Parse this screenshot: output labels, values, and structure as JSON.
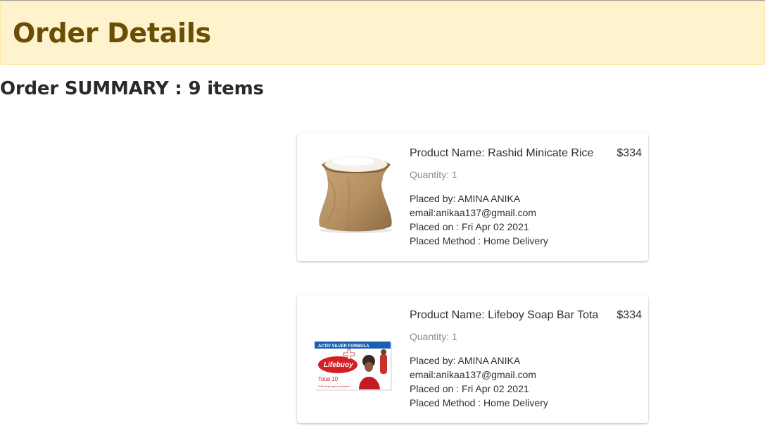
{
  "header": {
    "title": "Order Details"
  },
  "summary": {
    "text": "Order SUMMARY : 9 items"
  },
  "orders": [
    {
      "product_label": "Product Name: Rashid Minicate Rice",
      "price": "$334",
      "quantity": "Quantity: 1",
      "placed_by": "Placed by: AMINA ANIKA",
      "email": "email:anikaa137@gmail.com",
      "placed_on": "Placed on : Fri Apr 02 2021",
      "method": "Placed Method : Home Delivery",
      "image_icon": "rice-sack-image"
    },
    {
      "product_label": "Product Name: Lifeboy Soap Bar Tota",
      "price": "$334",
      "quantity": "Quantity: 1",
      "placed_by": "Placed by: AMINA ANIKA",
      "email": "email:anikaa137@gmail.com",
      "placed_on": "Placed on : Fri Apr 02 2021",
      "method": "Placed Method : Home Delivery",
      "image_icon": "soap-box-image",
      "image_text": {
        "banner": "ACTIV SILVER FORMULA",
        "brand": "Lifebuoy",
        "variant": "Total 10",
        "tagline": "100% better germ protection*"
      }
    }
  ],
  "colors": {
    "banner_bg": "#fff3cd",
    "banner_text": "#6b4e05",
    "soap_red": "#d32027"
  }
}
